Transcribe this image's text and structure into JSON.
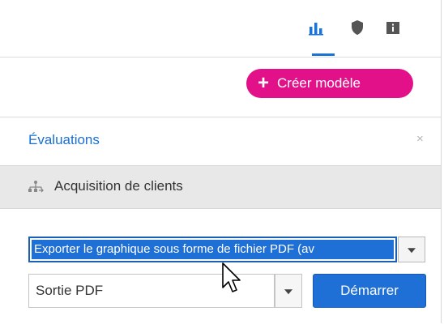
{
  "tabs": [
    {
      "icon": "bar-chart-icon",
      "active": true
    },
    {
      "icon": "shield-icon",
      "active": false
    },
    {
      "icon": "info-icon",
      "active": false
    }
  ],
  "accent_color": "#1a73d9",
  "create_button": {
    "label": "Créer modèle",
    "color": "#e2118a",
    "icon": "plus-icon"
  },
  "panel": {
    "title": "Évaluations",
    "close": "×",
    "section": {
      "icon": "hierarchy-icon",
      "label": "Acquisition de clients"
    }
  },
  "export": {
    "selected": "Exporter le graphique sous forme de fichier PDF (av"
  },
  "output": {
    "selected": "Sortie PDF",
    "start_label": "Démarrer"
  }
}
